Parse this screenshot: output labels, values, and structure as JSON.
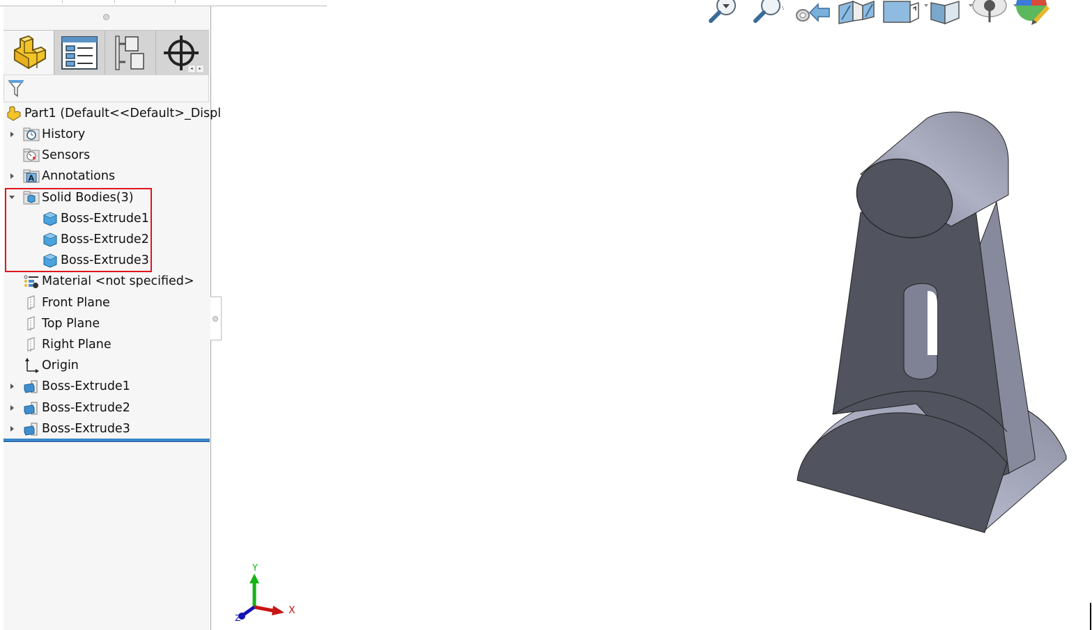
{
  "feature_manager": {
    "tabs": [
      {
        "name": "FeatureManager Design Tree",
        "icon": "part-icon",
        "active": true
      },
      {
        "name": "PropertyManager",
        "icon": "property-manager-icon",
        "active": false
      },
      {
        "name": "ConfigurationManager",
        "icon": "configuration-manager-icon",
        "active": false
      },
      {
        "name": "DimXpertManager",
        "icon": "dimxpert-icon",
        "active": false
      }
    ],
    "filter_icon": "filter-icon",
    "root": {
      "label": "Part1  (Default<<Default>_Displ",
      "icon": "part-icon"
    },
    "items": [
      {
        "label": "History",
        "icon": "history-folder-icon",
        "expander": "collapsed",
        "indent": 0
      },
      {
        "label": "Sensors",
        "icon": "sensors-folder-icon",
        "expander": "none",
        "indent": 0
      },
      {
        "label": "Annotations",
        "icon": "annotations-folder-icon",
        "expander": "collapsed",
        "indent": 0
      },
      {
        "label": "Solid Bodies(3)",
        "icon": "solid-bodies-folder-icon",
        "expander": "expanded",
        "indent": 0
      },
      {
        "label": "Boss-Extrude1",
        "icon": "solid-body-icon",
        "expander": "none",
        "indent": 1
      },
      {
        "label": "Boss-Extrude2",
        "icon": "solid-body-icon",
        "expander": "none",
        "indent": 1
      },
      {
        "label": "Boss-Extrude3",
        "icon": "solid-body-icon",
        "expander": "none",
        "indent": 1
      },
      {
        "label": "Material <not specified>",
        "icon": "material-icon",
        "expander": "none",
        "indent": 0
      },
      {
        "label": "Front Plane",
        "icon": "plane-icon",
        "expander": "none",
        "indent": 0
      },
      {
        "label": "Top Plane",
        "icon": "plane-icon",
        "expander": "none",
        "indent": 0
      },
      {
        "label": "Right Plane",
        "icon": "plane-icon",
        "expander": "none",
        "indent": 0
      },
      {
        "label": "Origin",
        "icon": "origin-icon",
        "expander": "none",
        "indent": 0
      },
      {
        "label": "Boss-Extrude1",
        "icon": "extrude-feature-icon",
        "expander": "collapsed",
        "indent": 0
      },
      {
        "label": "Boss-Extrude2",
        "icon": "extrude-feature-icon",
        "expander": "collapsed",
        "indent": 0
      },
      {
        "label": "Boss-Extrude3",
        "icon": "extrude-feature-icon",
        "expander": "collapsed",
        "indent": 0
      }
    ],
    "highlight_color": "#e0141e",
    "rollback_bar_color": "#3a86c8"
  },
  "heads_up_toolbar": [
    {
      "name": "zoom-to-fit",
      "icon": "zoom-to-fit-icon",
      "dropdown": false
    },
    {
      "name": "zoom-to-area",
      "icon": "zoom-to-area-icon",
      "dropdown": false
    },
    {
      "name": "previous-view",
      "icon": "previous-view-icon",
      "dropdown": false
    },
    {
      "name": "section-view",
      "icon": "section-view-icon",
      "dropdown": false
    },
    {
      "name": "view-orientation",
      "icon": "view-orientation-icon",
      "dropdown": true
    },
    {
      "name": "display-style",
      "icon": "display-style-icon",
      "dropdown": true
    },
    {
      "name": "hide-show-items",
      "icon": "hide-show-items-icon",
      "dropdown": true
    },
    {
      "name": "edit-appearance",
      "icon": "edit-appearance-icon",
      "dropdown": false
    }
  ],
  "triad": {
    "x_label": "X",
    "y_label": "Y",
    "z_label": "Z",
    "x_color": "#c81414",
    "y_color": "#14b414",
    "z_color": "#1414b4"
  },
  "model": {
    "face_dark": "#51535e",
    "face_light": "#8a8d9e",
    "face_highlight": "#b0b3c6"
  }
}
